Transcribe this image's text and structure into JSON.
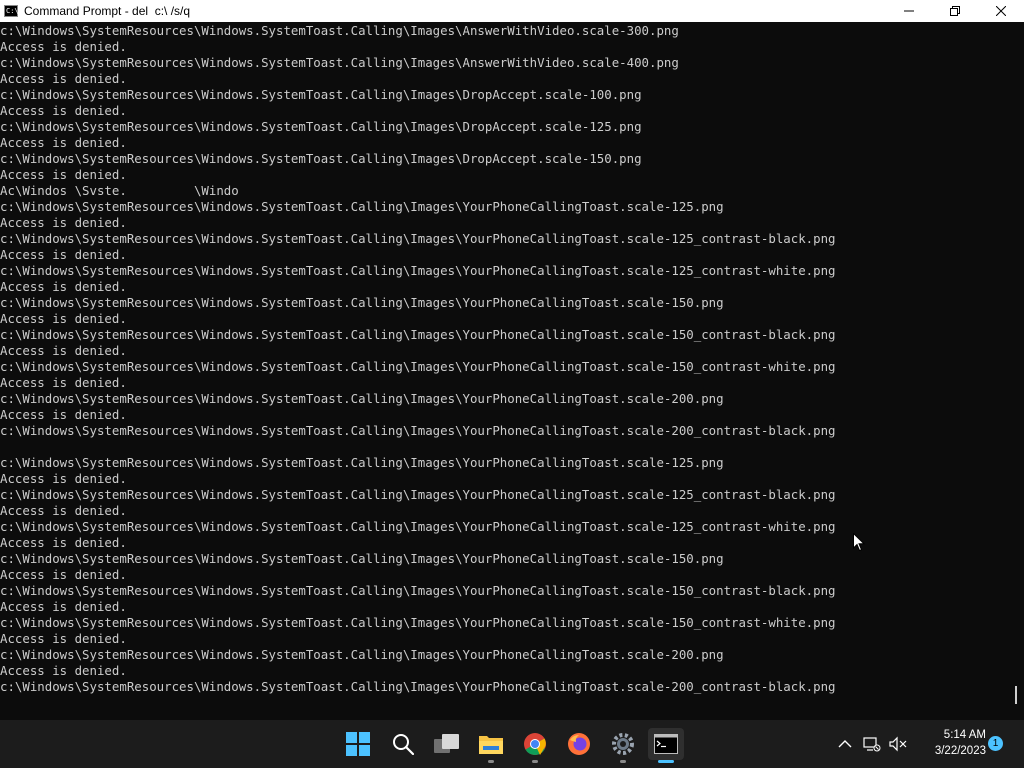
{
  "window": {
    "title": "Command Prompt - del  c:\\ /s/q",
    "icon": "cmd-icon"
  },
  "console": {
    "lines": [
      "c:\\Windows\\SystemResources\\Windows.SystemToast.Calling\\Images\\AnswerWithVideo.scale-300.png",
      "Access is denied.",
      "c:\\Windows\\SystemResources\\Windows.SystemToast.Calling\\Images\\AnswerWithVideo.scale-400.png",
      "Access is denied.",
      "c:\\Windows\\SystemResources\\Windows.SystemToast.Calling\\Images\\DropAccept.scale-100.png",
      "Access is denied.",
      "c:\\Windows\\SystemResources\\Windows.SystemToast.Calling\\Images\\DropAccept.scale-125.png",
      "Access is denied.",
      "c:\\Windows\\SystemResources\\Windows.SystemToast.Calling\\Images\\DropAccept.scale-150.png",
      "Access is denied.",
      "Ac\\Windos \\Svste.         \\Windo",
      "c:\\Windows\\SystemResources\\Windows.SystemToast.Calling\\Images\\YourPhoneCallingToast.scale-125.png",
      "Access is denied.",
      "c:\\Windows\\SystemResources\\Windows.SystemToast.Calling\\Images\\YourPhoneCallingToast.scale-125_contrast-black.png",
      "Access is denied.",
      "c:\\Windows\\SystemResources\\Windows.SystemToast.Calling\\Images\\YourPhoneCallingToast.scale-125_contrast-white.png",
      "Access is denied.",
      "c:\\Windows\\SystemResources\\Windows.SystemToast.Calling\\Images\\YourPhoneCallingToast.scale-150.png",
      "Access is denied.",
      "c:\\Windows\\SystemResources\\Windows.SystemToast.Calling\\Images\\YourPhoneCallingToast.scale-150_contrast-black.png",
      "Access is denied.",
      "c:\\Windows\\SystemResources\\Windows.SystemToast.Calling\\Images\\YourPhoneCallingToast.scale-150_contrast-white.png",
      "Access is denied.",
      "c:\\Windows\\SystemResources\\Windows.SystemToast.Calling\\Images\\YourPhoneCallingToast.scale-200.png",
      "Access is denied.",
      "c:\\Windows\\SystemResources\\Windows.SystemToast.Calling\\Images\\YourPhoneCallingToast.scale-200_contrast-black.png",
      "",
      "c:\\Windows\\SystemResources\\Windows.SystemToast.Calling\\Images\\YourPhoneCallingToast.scale-125.png",
      "Access is denied.",
      "c:\\Windows\\SystemResources\\Windows.SystemToast.Calling\\Images\\YourPhoneCallingToast.scale-125_contrast-black.png",
      "Access is denied.",
      "c:\\Windows\\SystemResources\\Windows.SystemToast.Calling\\Images\\YourPhoneCallingToast.scale-125_contrast-white.png",
      "Access is denied.",
      "c:\\Windows\\SystemResources\\Windows.SystemToast.Calling\\Images\\YourPhoneCallingToast.scale-150.png",
      "Access is denied.",
      "c:\\Windows\\SystemResources\\Windows.SystemToast.Calling\\Images\\YourPhoneCallingToast.scale-150_contrast-black.png",
      "Access is denied.",
      "c:\\Windows\\SystemResources\\Windows.SystemToast.Calling\\Images\\YourPhoneCallingToast.scale-150_contrast-white.png",
      "Access is denied.",
      "c:\\Windows\\SystemResources\\Windows.SystemToast.Calling\\Images\\YourPhoneCallingToast.scale-200.png",
      "Access is denied.",
      "c:\\Windows\\SystemResources\\Windows.SystemToast.Calling\\Images\\YourPhoneCallingToast.scale-200_contrast-black.png"
    ],
    "text_color": "#cccccc",
    "background": "#0c0c0c"
  },
  "taskbar": {
    "apps": [
      {
        "name": "start-button",
        "icon": "windows-logo-icon"
      },
      {
        "name": "search-button",
        "icon": "search-icon"
      },
      {
        "name": "task-view-button",
        "icon": "task-view-icon"
      },
      {
        "name": "file-explorer-button",
        "icon": "folder-icon"
      },
      {
        "name": "chrome-button",
        "icon": "chrome-icon"
      },
      {
        "name": "firefox-button",
        "icon": "firefox-icon"
      },
      {
        "name": "settings-button",
        "icon": "gear-icon"
      },
      {
        "name": "terminal-button",
        "icon": "terminal-icon",
        "active": true
      }
    ],
    "clock": {
      "time": "5:14 AM",
      "date": "3/22/2023"
    },
    "notification_count": "1",
    "accent": "#4cc2ff"
  }
}
